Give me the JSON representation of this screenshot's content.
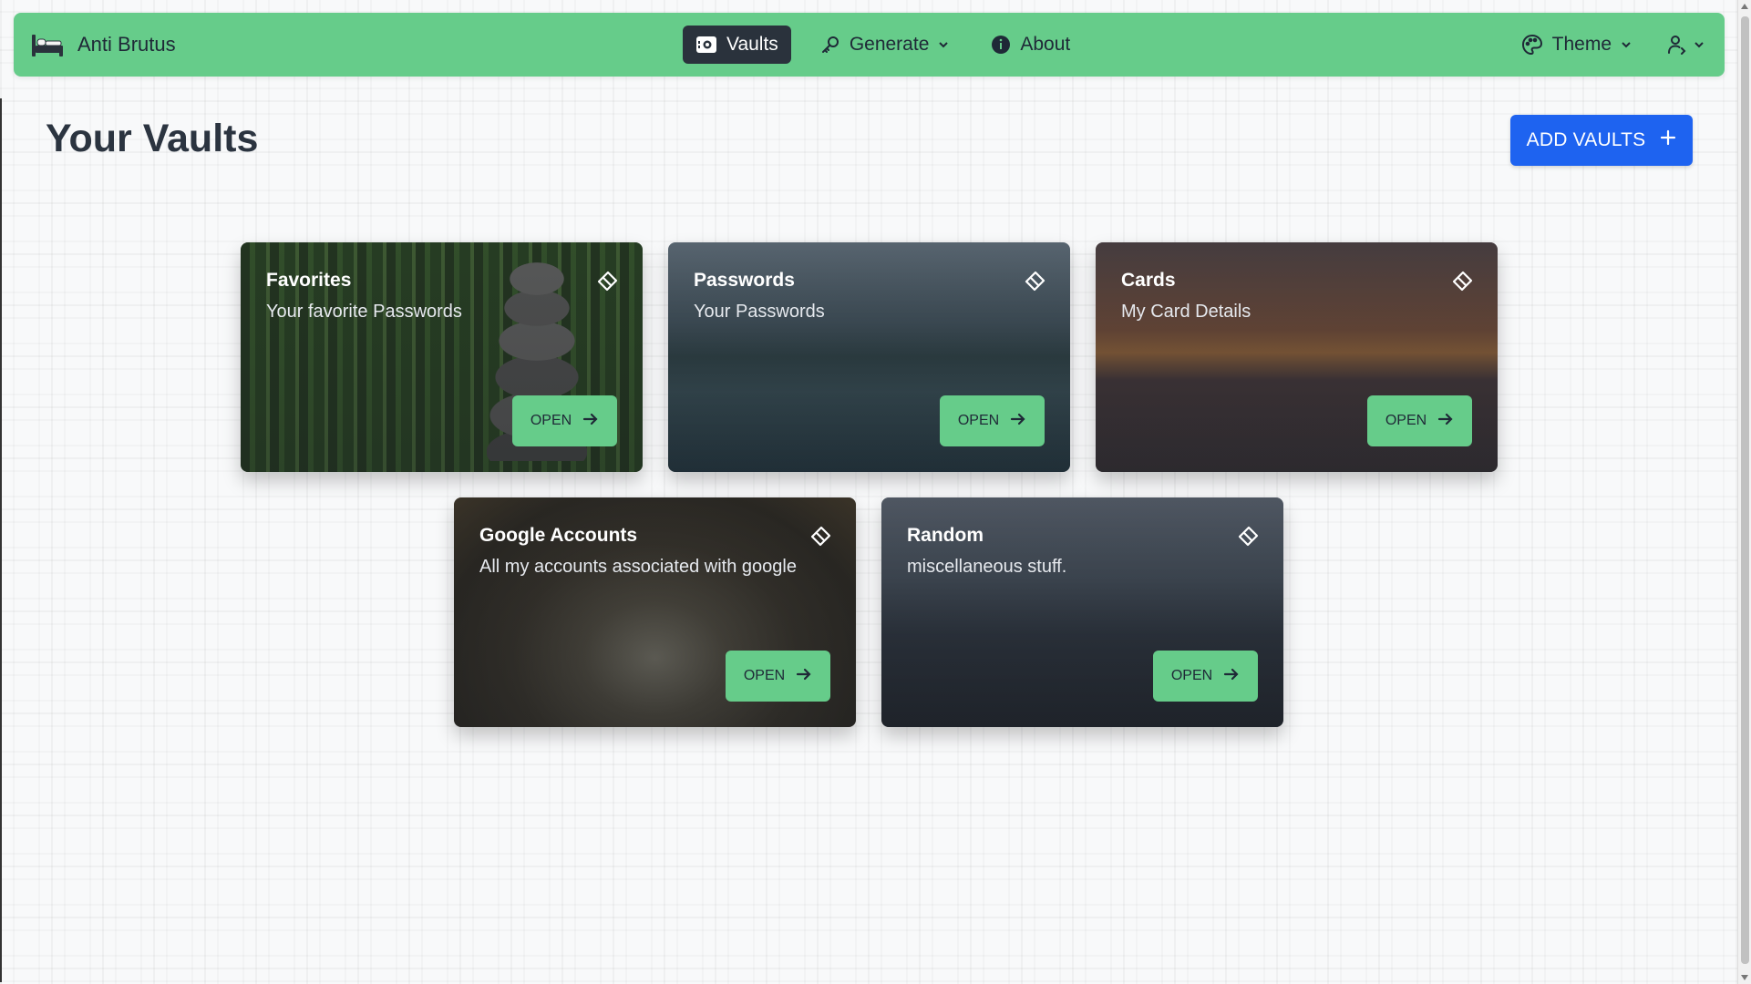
{
  "app": {
    "brand": "Anti Brutus"
  },
  "nav": {
    "vaults": "Vaults",
    "generate": "Generate",
    "about": "About",
    "theme": "Theme"
  },
  "page": {
    "title": "Your Vaults",
    "add_button": "ADD VAULTS"
  },
  "vaults": [
    {
      "title": "Favorites",
      "description": "Your favorite Passwords",
      "open": "OPEN"
    },
    {
      "title": "Passwords",
      "description": "Your Passwords",
      "open": "OPEN"
    },
    {
      "title": "Cards",
      "description": "My Card Details",
      "open": "OPEN"
    },
    {
      "title": "Google Accounts",
      "description": "All my accounts associated with google",
      "open": "OPEN"
    },
    {
      "title": "Random",
      "description": "miscellaneous stuff.",
      "open": "OPEN"
    }
  ],
  "colors": {
    "navbar": "#66cc8a",
    "active_nav": "#2a323c",
    "primary": "#1e63f0",
    "open_button": "#66cc8a"
  },
  "icons": {
    "brand": "bed-icon",
    "vaults": "vault-icon",
    "generate": "key-icon",
    "about": "info-icon",
    "theme": "palette-icon",
    "user": "user-icon",
    "edit": "eraser-icon",
    "open": "arrow-right-icon",
    "add": "plus-icon"
  }
}
